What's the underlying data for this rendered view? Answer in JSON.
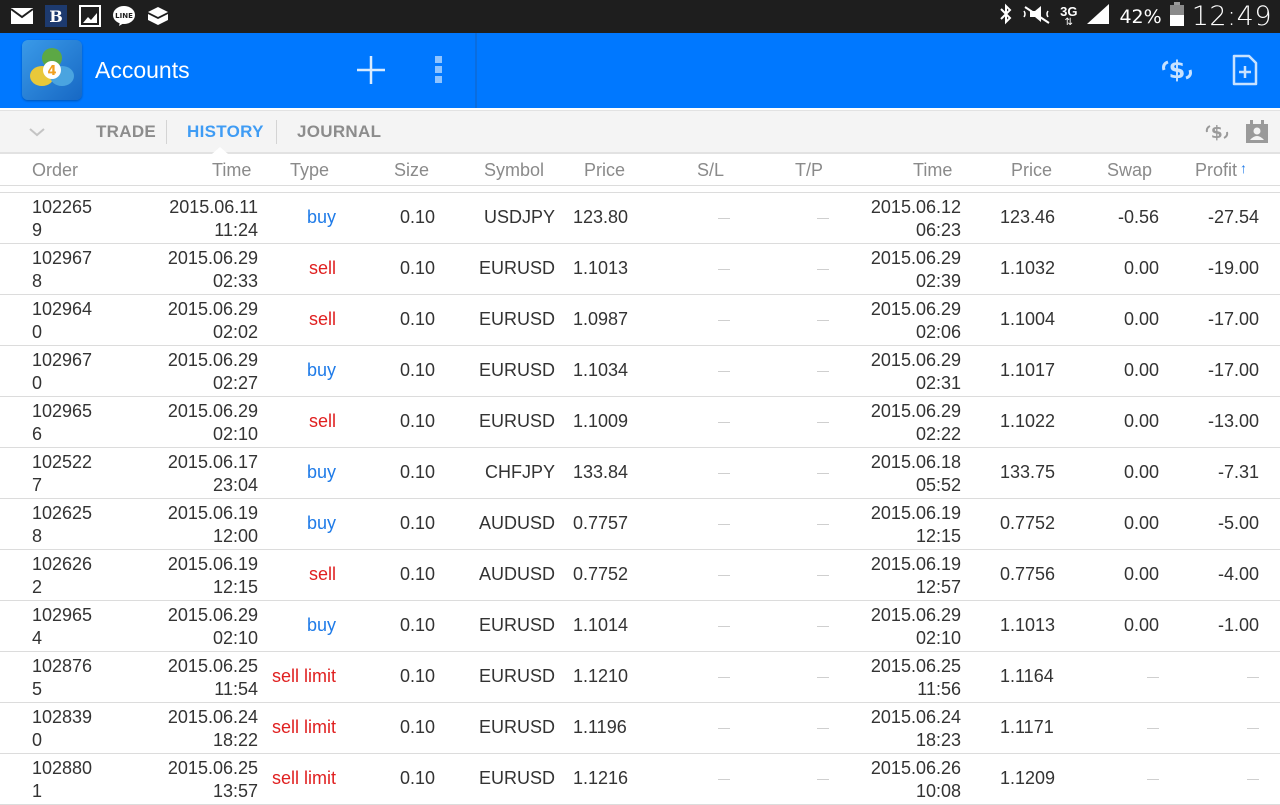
{
  "status_bar": {
    "left_icons": [
      "mail-icon",
      "b-app-icon",
      "gallery-icon",
      "line-app-icon",
      "dropbox-icon"
    ],
    "right_icons": [
      "bluetooth-icon",
      "vibrate-mute-icon",
      "network-3g-icon",
      "signal-icon",
      "battery-icon"
    ],
    "network": "3G",
    "battery": "42%",
    "battery_level": 0.42,
    "time": "12:49"
  },
  "action_bar": {
    "title": "Accounts",
    "icons": {
      "logo": "metatrader4-logo",
      "add": "plus-icon",
      "menu": "overflow-menu-icon",
      "trade": "dollar-exchange-icon",
      "new_doc": "add-document-icon"
    }
  },
  "tabs": {
    "collapse_icon": "chevron-down-icon",
    "items": [
      {
        "label": "TRADE",
        "active": false
      },
      {
        "label": "HISTORY",
        "active": true
      },
      {
        "label": "JOURNAL",
        "active": false
      }
    ],
    "right_icons": [
      "dollar-exchange-icon",
      "calendar-contact-icon"
    ]
  },
  "table": {
    "headers": {
      "order": "Order",
      "open_time": "Time",
      "type": "Type",
      "size": "Size",
      "symbol": "Symbol",
      "open_price": "Price",
      "sl": "S/L",
      "tp": "T/P",
      "close_time": "Time",
      "close_price": "Price",
      "swap": "Swap",
      "profit": "Profit",
      "sort_indicator": "↑"
    },
    "dash": "—",
    "rows": [
      {
        "order_a": "102265",
        "order_b": "9",
        "otime_a": "2015.06.11",
        "otime_b": "11:24",
        "type": "buy",
        "size": "0.10",
        "symbol": "USDJPY",
        "oprice": "123.80",
        "sl": "",
        "tp": "",
        "ctime_a": "2015.06.12",
        "ctime_b": "06:23",
        "cprice": "123.46",
        "swap": "-0.56",
        "profit": "-27.54"
      },
      {
        "order_a": "102967",
        "order_b": "8",
        "otime_a": "2015.06.29",
        "otime_b": "02:33",
        "type": "sell",
        "size": "0.10",
        "symbol": "EURUSD",
        "oprice": "1.1013",
        "sl": "",
        "tp": "",
        "ctime_a": "2015.06.29",
        "ctime_b": "02:39",
        "cprice": "1.1032",
        "swap": "0.00",
        "profit": "-19.00"
      },
      {
        "order_a": "102964",
        "order_b": "0",
        "otime_a": "2015.06.29",
        "otime_b": "02:02",
        "type": "sell",
        "size": "0.10",
        "symbol": "EURUSD",
        "oprice": "1.0987",
        "sl": "",
        "tp": "",
        "ctime_a": "2015.06.29",
        "ctime_b": "02:06",
        "cprice": "1.1004",
        "swap": "0.00",
        "profit": "-17.00"
      },
      {
        "order_a": "102967",
        "order_b": "0",
        "otime_a": "2015.06.29",
        "otime_b": "02:27",
        "type": "buy",
        "size": "0.10",
        "symbol": "EURUSD",
        "oprice": "1.1034",
        "sl": "",
        "tp": "",
        "ctime_a": "2015.06.29",
        "ctime_b": "02:31",
        "cprice": "1.1017",
        "swap": "0.00",
        "profit": "-17.00"
      },
      {
        "order_a": "102965",
        "order_b": "6",
        "otime_a": "2015.06.29",
        "otime_b": "02:10",
        "type": "sell",
        "size": "0.10",
        "symbol": "EURUSD",
        "oprice": "1.1009",
        "sl": "",
        "tp": "",
        "ctime_a": "2015.06.29",
        "ctime_b": "02:22",
        "cprice": "1.1022",
        "swap": "0.00",
        "profit": "-13.00"
      },
      {
        "order_a": "102522",
        "order_b": "7",
        "otime_a": "2015.06.17",
        "otime_b": "23:04",
        "type": "buy",
        "size": "0.10",
        "symbol": "CHFJPY",
        "oprice": "133.84",
        "sl": "",
        "tp": "",
        "ctime_a": "2015.06.18",
        "ctime_b": "05:52",
        "cprice": "133.75",
        "swap": "0.00",
        "profit": "-7.31"
      },
      {
        "order_a": "102625",
        "order_b": "8",
        "otime_a": "2015.06.19",
        "otime_b": "12:00",
        "type": "buy",
        "size": "0.10",
        "symbol": "AUDUSD",
        "oprice": "0.7757",
        "sl": "",
        "tp": "",
        "ctime_a": "2015.06.19",
        "ctime_b": "12:15",
        "cprice": "0.7752",
        "swap": "0.00",
        "profit": "-5.00"
      },
      {
        "order_a": "102626",
        "order_b": "2",
        "otime_a": "2015.06.19",
        "otime_b": "12:15",
        "type": "sell",
        "size": "0.10",
        "symbol": "AUDUSD",
        "oprice": "0.7752",
        "sl": "",
        "tp": "",
        "ctime_a": "2015.06.19",
        "ctime_b": "12:57",
        "cprice": "0.7756",
        "swap": "0.00",
        "profit": "-4.00"
      },
      {
        "order_a": "102965",
        "order_b": "4",
        "otime_a": "2015.06.29",
        "otime_b": "02:10",
        "type": "buy",
        "size": "0.10",
        "symbol": "EURUSD",
        "oprice": "1.1014",
        "sl": "",
        "tp": "",
        "ctime_a": "2015.06.29",
        "ctime_b": "02:10",
        "cprice": "1.1013",
        "swap": "0.00",
        "profit": "-1.00"
      },
      {
        "order_a": "102876",
        "order_b": "5",
        "otime_a": "2015.06.25",
        "otime_b": "11:54",
        "type": "sell limit",
        "size": "0.10",
        "symbol": "EURUSD",
        "oprice": "1.1210",
        "sl": "",
        "tp": "",
        "ctime_a": "2015.06.25",
        "ctime_b": "11:56",
        "cprice": "1.1164",
        "swap": "",
        "profit": ""
      },
      {
        "order_a": "102839",
        "order_b": "0",
        "otime_a": "2015.06.24",
        "otime_b": "18:22",
        "type": "sell limit",
        "size": "0.10",
        "symbol": "EURUSD",
        "oprice": "1.1196",
        "sl": "",
        "tp": "",
        "ctime_a": "2015.06.24",
        "ctime_b": "18:23",
        "cprice": "1.1171",
        "swap": "",
        "profit": ""
      },
      {
        "order_a": "102880",
        "order_b": "1",
        "otime_a": "2015.06.25",
        "otime_b": "13:57",
        "type": "sell limit",
        "size": "0.10",
        "symbol": "EURUSD",
        "oprice": "1.1216",
        "sl": "",
        "tp": "",
        "ctime_a": "2015.06.26",
        "ctime_b": "10:08",
        "cprice": "1.1209",
        "swap": "",
        "profit": ""
      }
    ]
  },
  "colors": {
    "accent": "#0078ff",
    "active_tab": "#3f9cf4",
    "buy": "#1f7be8",
    "sell": "#e02020"
  }
}
